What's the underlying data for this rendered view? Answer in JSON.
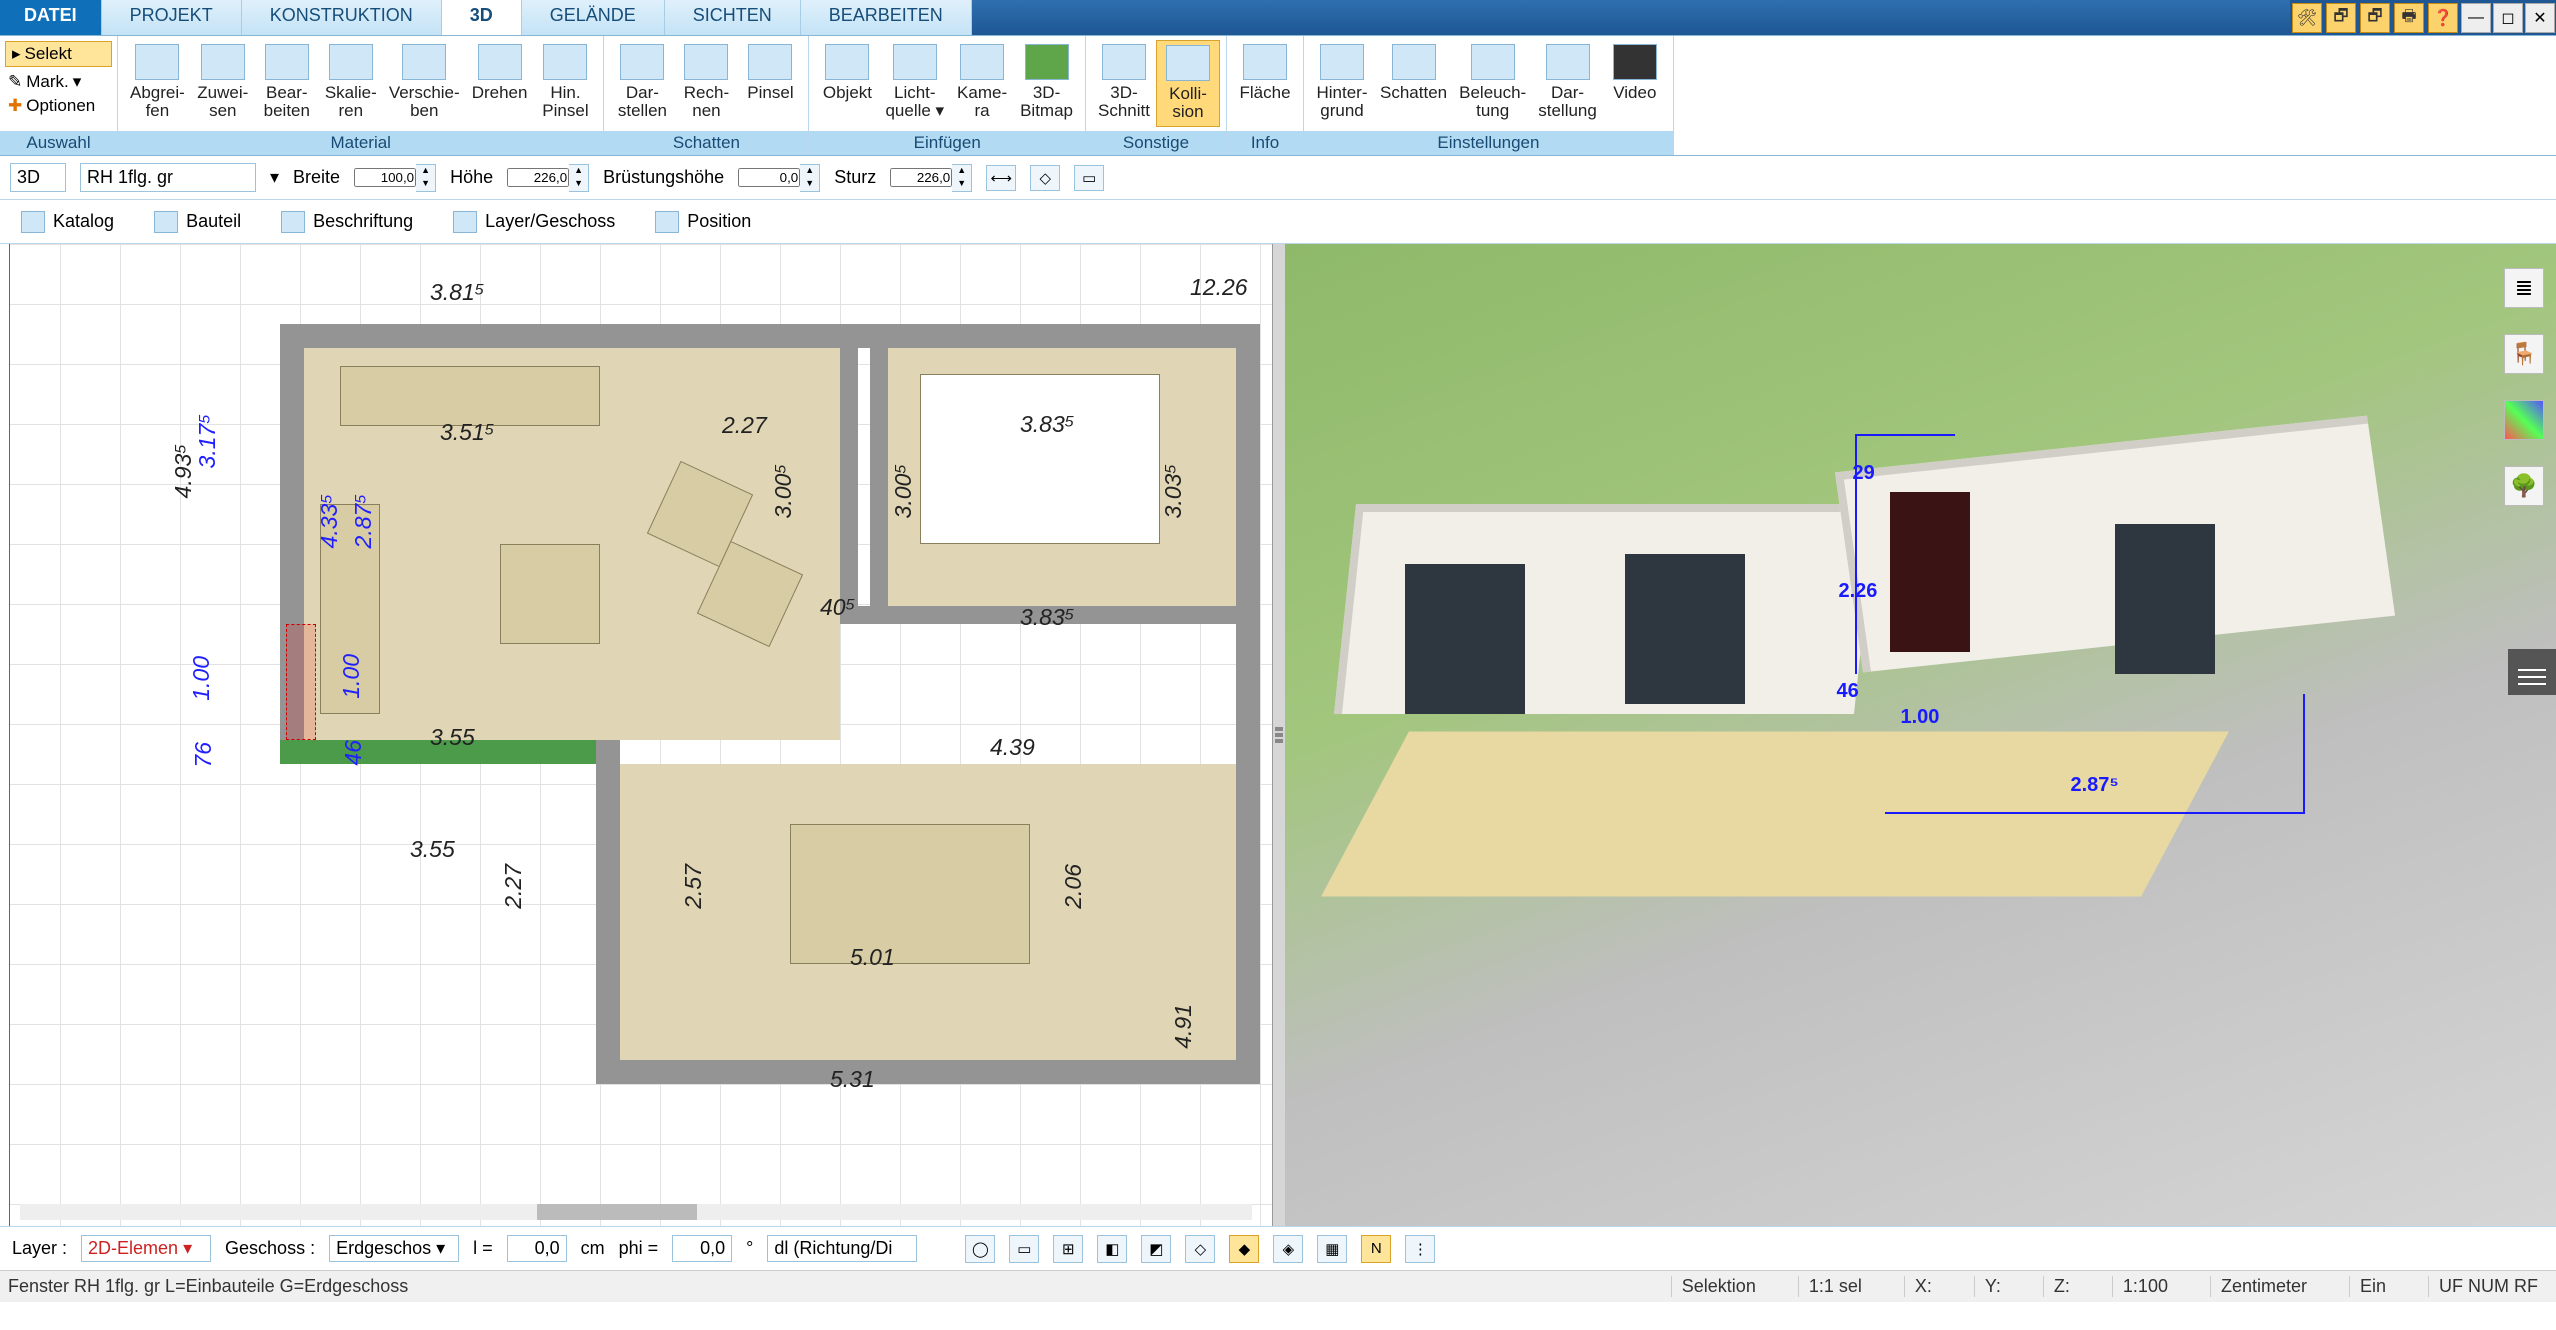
{
  "menu": {
    "tabs": [
      "DATEI",
      "PROJEKT",
      "KONSTRUKTION",
      "3D",
      "GELÄNDE",
      "SICHTEN",
      "BEARBEITEN"
    ],
    "active": "3D",
    "right_icons": [
      "🛠",
      "🗗",
      "🗗",
      "🖶",
      "❓"
    ],
    "win_icons": [
      "—",
      "◻",
      "✕"
    ]
  },
  "selection_panel": {
    "selekt": "Selekt",
    "mark": "Mark.",
    "optionen": "Optionen",
    "label": "Auswahl"
  },
  "ribbon": [
    {
      "name": "material",
      "label": "Material",
      "buttons": [
        "Abgrei-\nfen",
        "Zuwei-\nsen",
        "Bear-\nbeiten",
        "Skalie-\nren",
        "Verschie-\nben",
        "Drehen",
        "Hin.\nPinsel"
      ]
    },
    {
      "name": "schatten",
      "label": "Schatten",
      "buttons": [
        "Dar-\nstellen",
        "Rech-\nnen",
        "Pinsel"
      ]
    },
    {
      "name": "einfuegen",
      "label": "Einfügen",
      "buttons": [
        "Objekt",
        "Licht-\nquelle ▾",
        "Kame-\nra",
        "3D-\nBitmap"
      ]
    },
    {
      "name": "sonstige",
      "label": "Sonstige",
      "buttons": [
        "3D-\nSchnitt",
        "Kolli-\nsion"
      ],
      "active_index": 1
    },
    {
      "name": "info",
      "label": "Info",
      "buttons": [
        "Fläche"
      ]
    },
    {
      "name": "einstellungen",
      "label": "Einstellungen",
      "buttons": [
        "Hinter-\ngrund",
        "Schatten",
        "Beleuch-\ntung",
        "Dar-\nstellung",
        "Video"
      ]
    }
  ],
  "propbar": {
    "mode": "3D",
    "element": "RH 1flg. gr",
    "breite_lbl": "Breite",
    "breite": "100,0",
    "hoehe_lbl": "Höhe",
    "hoehe": "226,0",
    "bruestung_lbl": "Brüstungshöhe",
    "bruestung": "0,0",
    "sturz_lbl": "Sturz",
    "sturz": "226,0"
  },
  "toolbar2": {
    "katalog": "Katalog",
    "bauteil": "Bauteil",
    "beschriftung": "Beschriftung",
    "layer": "Layer/Geschoss",
    "position": "Position"
  },
  "dims2d": {
    "top_381": "3.81⁵",
    "top_1226": "12.26",
    "r1_351": "3.51⁵",
    "r1_227": "2.27",
    "r1_383": "3.83⁵",
    "r1_383b": "3.83⁵",
    "bed_300": "3.00⁵",
    "bed_300b": "3.00⁵",
    "bed_303": "3.03⁵",
    "c40": "40⁵",
    "r2_355": "3.55",
    "r2_439": "4.39",
    "b_355": "3.55",
    "b_227": "2.27",
    "b_257": "2.57",
    "b_501": "5.01",
    "b_206": "2.06",
    "b_531": "5.31",
    "b_491": "4.91",
    "l_493": "4.93⁵",
    "l_317": "3.17⁵",
    "l_100": "1.00",
    "l_76": "76",
    "sel_287": "2.87⁵",
    "sel_100": "1.00",
    "sel_46": "46",
    "sel_433": "4.33⁵"
  },
  "dims3d": {
    "d1": "29",
    "d2": "2.26",
    "d3": "46",
    "d4": "1.00",
    "d5": "2.87⁵"
  },
  "status1": {
    "layer_lbl": "Layer :",
    "layer_val": "2D-Elemen ▾",
    "geschoss_lbl": "Geschoss :",
    "geschoss_val": "Erdgeschos ▾",
    "l_lbl": "l =",
    "l_val": "0,0",
    "unit": "cm",
    "phi_lbl": "phi =",
    "phi_val": "0,0",
    "deg": "°",
    "dir": "dl (Richtung/Di"
  },
  "status2": {
    "left": "Fenster RH 1flg. gr L=Einbauteile G=Erdgeschoss",
    "selektion": "Selektion",
    "ratio": "1:1 sel",
    "x": "X:",
    "y": "Y:",
    "z": "Z:",
    "scale": "1:100",
    "unit": "Zentimeter",
    "ein": "Ein",
    "uf": "UF NUM RF"
  }
}
